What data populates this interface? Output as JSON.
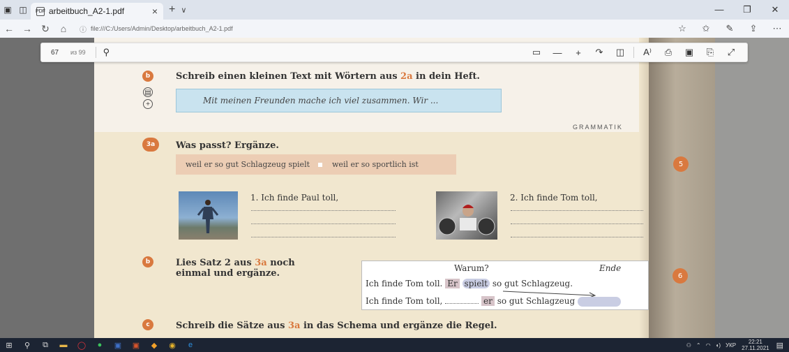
{
  "browser": {
    "tab_title": "arbeitbuch_A2-1.pdf",
    "url": "file:///C:/Users/Admin/Desktop/arbeitbuch_A2-1.pdf"
  },
  "pdf_toolbar": {
    "page_current": "67",
    "page_total": "из 99"
  },
  "exercise_2b": {
    "badge": "b",
    "heading": "Schreib einen kleinen Text mit Wörtern aus ",
    "heading_ref": "2a",
    "heading_end": " in dein Heft.",
    "example": "Mit meinen Freunden mache ich viel zusammen. Wir ..."
  },
  "section_label": "GRAMMATIK",
  "exercise_3a": {
    "badge": "3a",
    "heading": "Was passt? Ergänze.",
    "option1": "weil er so gut Schlagzeug spielt",
    "option2": "weil er so sportlich ist",
    "sentence1": "1. Ich finde Paul toll,",
    "sentence2": "2. Ich finde Tom toll,"
  },
  "exercise_3b": {
    "badge": "b",
    "heading_line1_pre": "Lies Satz 2 aus ",
    "heading_ref": "3a",
    "heading_line1_post": " noch",
    "heading_line2": "einmal und ergänze.",
    "table_warum": "Warum?",
    "table_ende": "Ende",
    "row1_pre": "Ich finde Tom toll.",
    "row1_er": "Er",
    "row1_spielt": "spielt",
    "row1_post": "so gut Schlagzeug.",
    "row2_pre": "Ich finde Tom toll,",
    "row2_er": "er",
    "row2_post": "so gut Schlagzeug"
  },
  "exercise_3c": {
    "badge": "c",
    "heading_pre": "Schreib die Sätze aus ",
    "heading_ref": "3a",
    "heading_post": " in das Schema und ergänze die Regel."
  },
  "side_badges": {
    "b5": "5",
    "b6": "6"
  },
  "taskbar": {
    "lang": "УКР",
    "time": "22:21",
    "date": "27.11.2021"
  }
}
